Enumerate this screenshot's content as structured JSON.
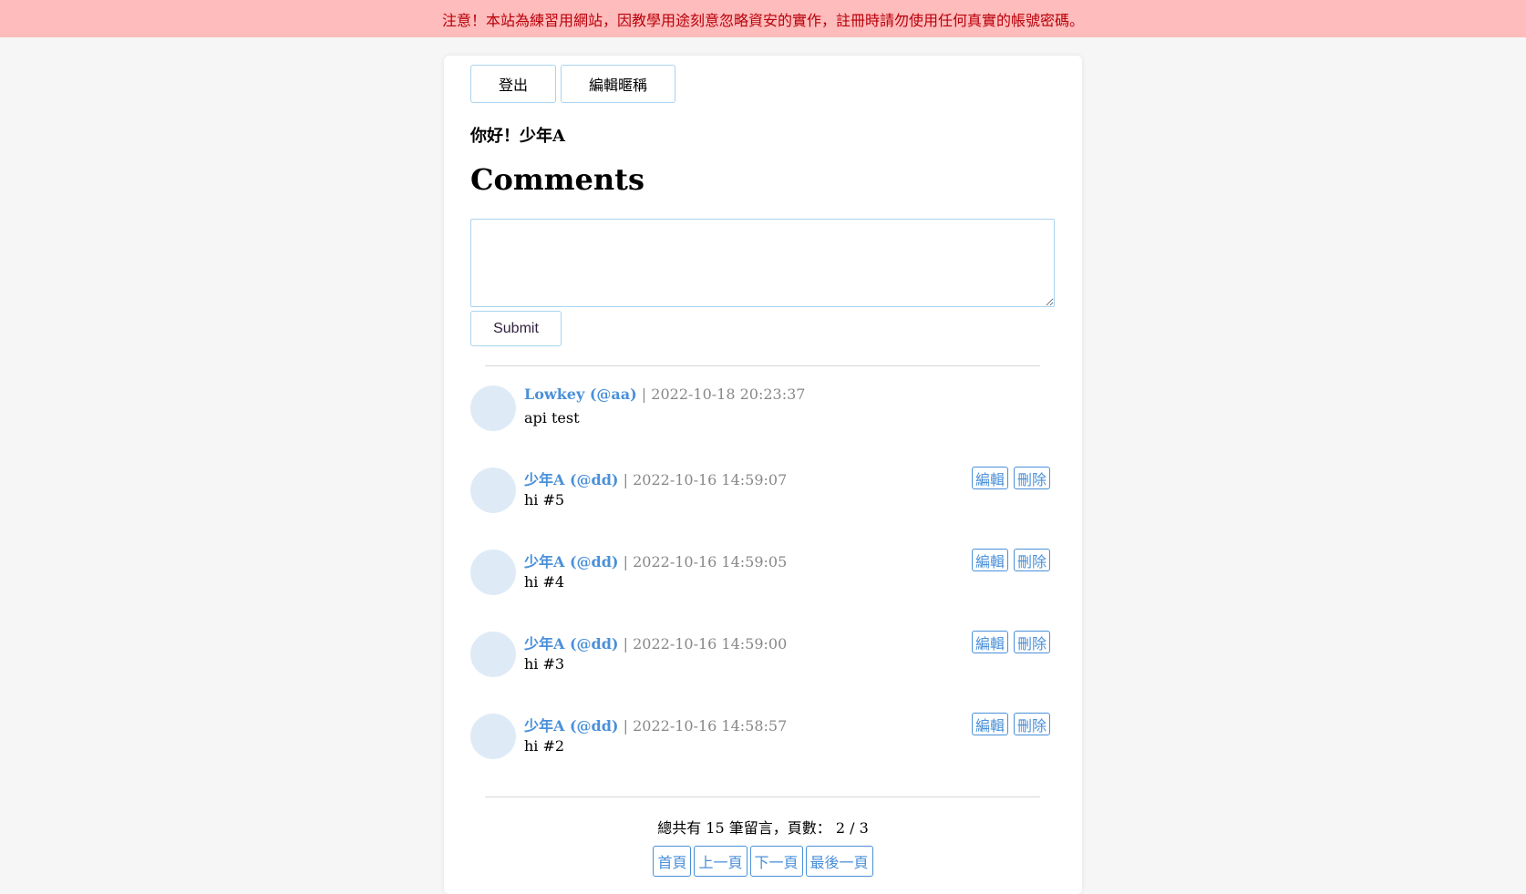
{
  "warning": "注意！本站為練習用網站，因教學用途刻意忽略資安的實作，註冊時請勿使用任何真實的帳號密碼。",
  "header": {
    "logout_label": "登出",
    "edit_nickname_label": "編輯暱稱",
    "greeting": "你好！少年A"
  },
  "page_title": "Comments",
  "form": {
    "textarea_value": "",
    "submit_label": "Submit"
  },
  "comments": [
    {
      "author": "Lowkey (@aa)",
      "separator": "|",
      "time": "2022-10-18 20:23:37",
      "content": "api test",
      "editable": false
    },
    {
      "author": "少年A (@dd)",
      "separator": "|",
      "time": "2022-10-16 14:59:07",
      "content": "hi #5",
      "editable": true
    },
    {
      "author": "少年A (@dd)",
      "separator": "|",
      "time": "2022-10-16 14:59:05",
      "content": "hi #4",
      "editable": true
    },
    {
      "author": "少年A (@dd)",
      "separator": "|",
      "time": "2022-10-16 14:59:00",
      "content": "hi #3",
      "editable": true
    },
    {
      "author": "少年A (@dd)",
      "separator": "|",
      "time": "2022-10-16 14:58:57",
      "content": "hi #2",
      "editable": true
    }
  ],
  "comment_actions": {
    "edit_label": "編輯",
    "delete_label": "刪除"
  },
  "page_info": "總共有 15 筆留言，頁數： 2 / 3",
  "pagination": {
    "first_label": "首頁",
    "prev_label": "上一頁",
    "next_label": "下一頁",
    "last_label": "最後一頁"
  },
  "colors": {
    "warning_bg": "#ffbcbc",
    "warning_text": "#b8000a",
    "accent": "#4a90d9",
    "avatar": "#deebf7",
    "border": "#a9d3ef"
  }
}
